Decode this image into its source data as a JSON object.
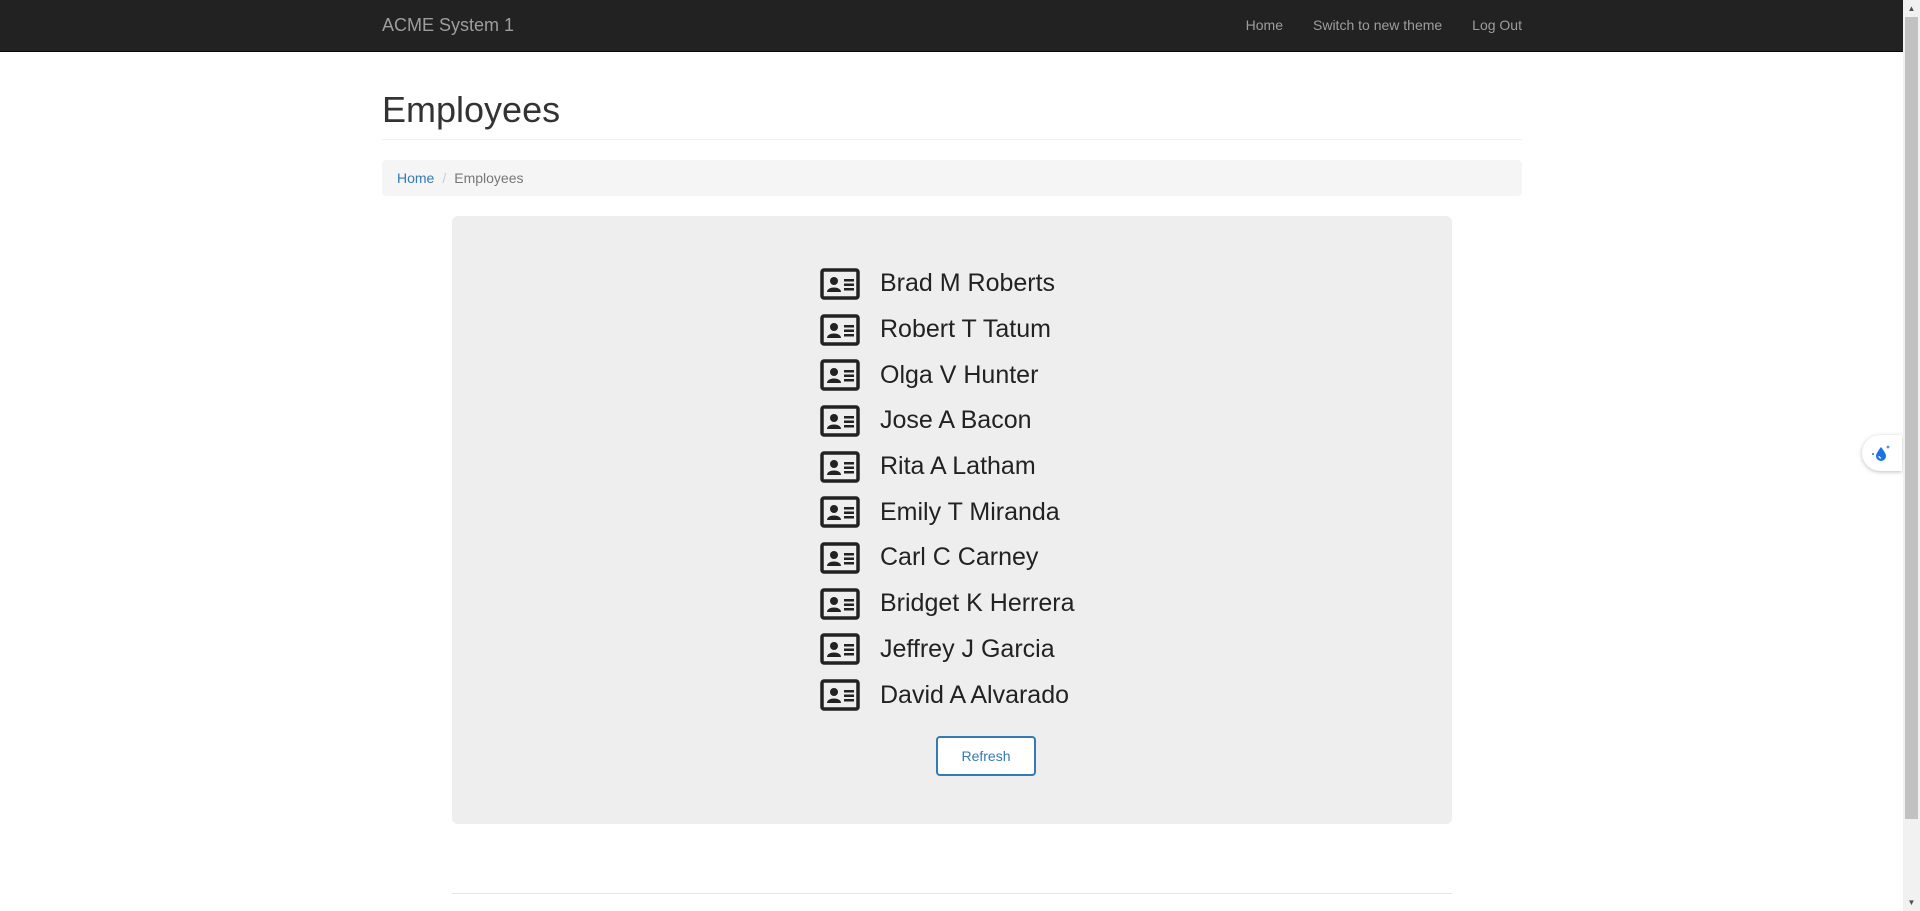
{
  "navbar": {
    "brand": "ACME System 1",
    "links": [
      "Home",
      "Switch to new theme",
      "Log Out"
    ]
  },
  "page": {
    "title": "Employees"
  },
  "breadcrumb": {
    "home": "Home",
    "separator": "/",
    "current": "Employees"
  },
  "employees": [
    "Brad M Roberts",
    "Robert T Tatum",
    "Olga V Hunter",
    "Jose A Bacon",
    "Rita A Latham",
    "Emily T Miranda",
    "Carl C Carney",
    "Bridget K Herrera",
    "Jeffrey J Garcia",
    "David A Alvarado"
  ],
  "employee_icon": "id-card-icon",
  "actions": {
    "refresh_label": "Refresh"
  },
  "colors": {
    "navbar_bg": "#222222",
    "link": "#337ab7",
    "panel_bg": "#eeeeee"
  }
}
